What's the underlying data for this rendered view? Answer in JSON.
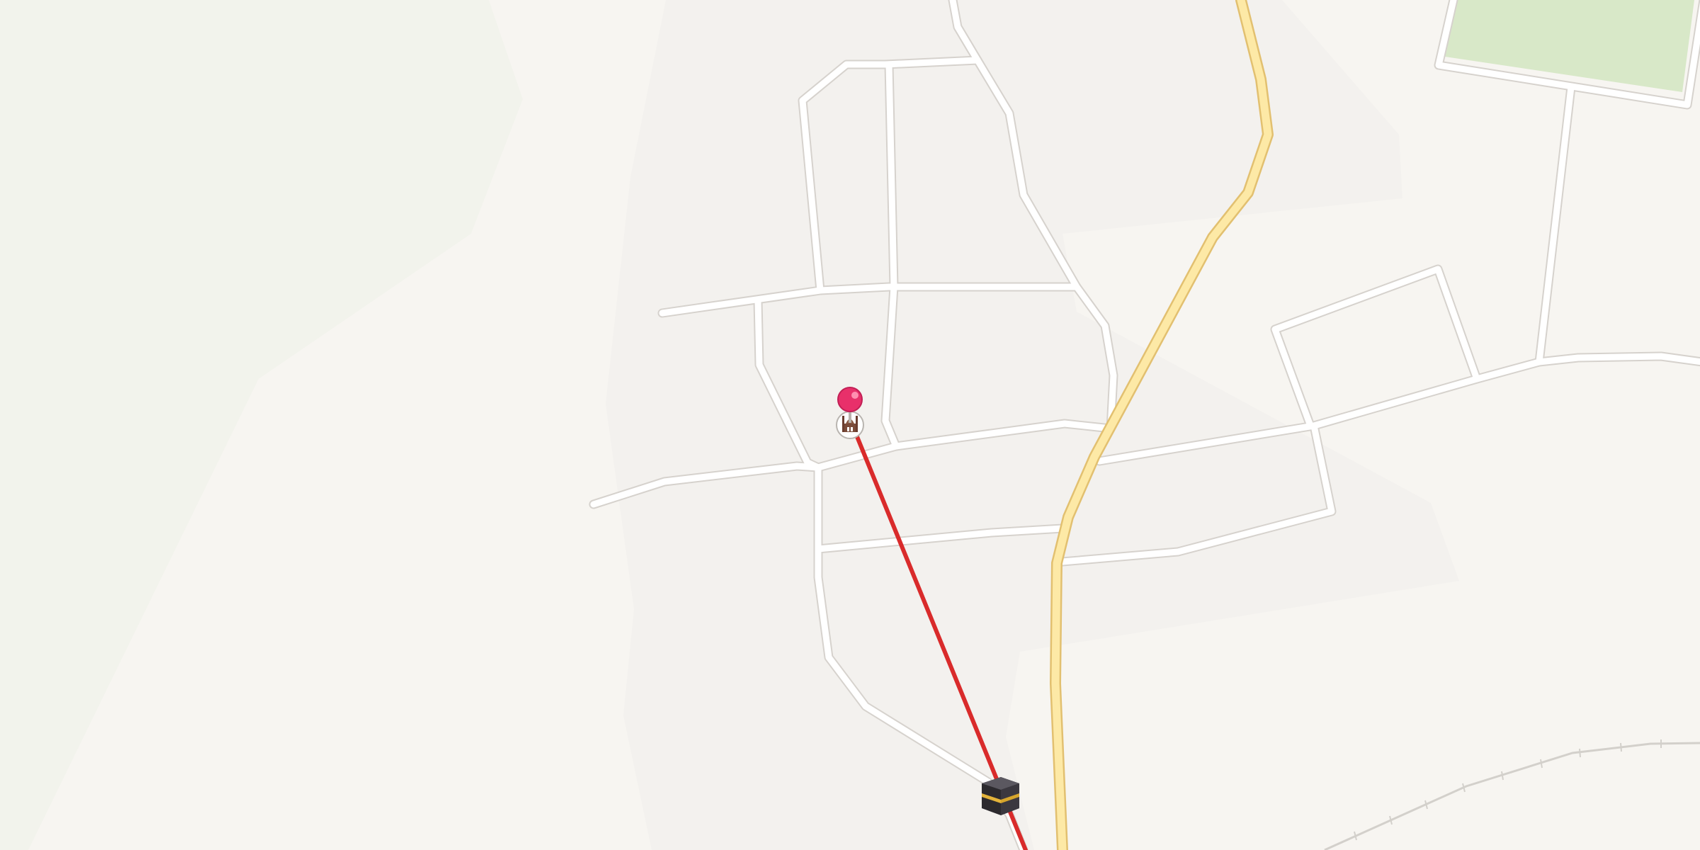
{
  "map": {
    "colors": {
      "background": "#f7f5f1",
      "land_left": "#f2f3ec",
      "residential": "#f3f1ee",
      "park": "#d8e8c8",
      "minor_road": "#ffffff",
      "minor_road_outline": "#d6d2cd",
      "major_road": "#fde9a6",
      "major_road_outline": "#e2c070",
      "direction_line": "#d92b2b",
      "rail": "#d3d0cb",
      "pin": "#e8306a"
    },
    "markers": {
      "location_pin": {
        "icon": "map-pin-icon"
      },
      "mosque": {
        "icon": "mosque-icon"
      },
      "kaaba": {
        "icon": "kaaba-icon"
      }
    },
    "direction_line": {
      "icon": "qibla-direction-line"
    }
  }
}
